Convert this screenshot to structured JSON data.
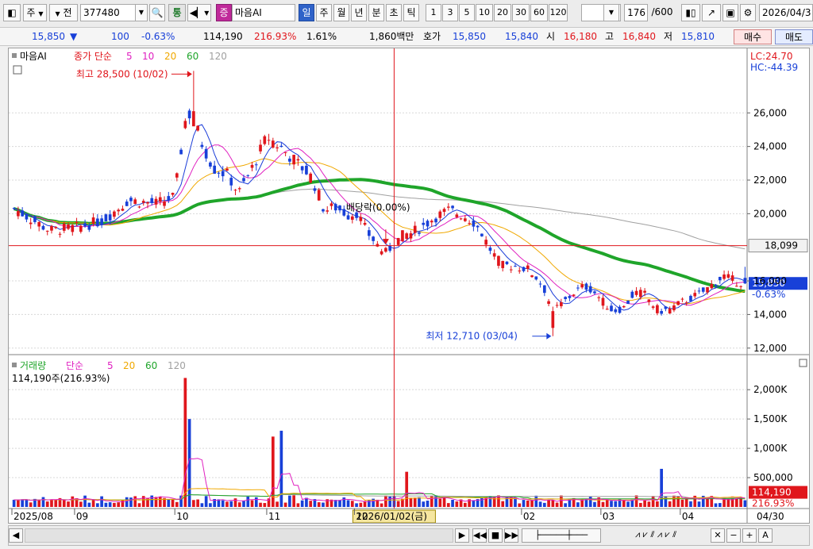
{
  "toolbar": {
    "stock_type": "주",
    "period_label": "전",
    "code": "377480",
    "tong_label": "통",
    "jeung_label": "증",
    "stock_name": "마음AI",
    "periods": [
      "일",
      "주",
      "월",
      "년",
      "분",
      "초",
      "틱"
    ],
    "active_period": "일",
    "minutes": [
      "1",
      "3",
      "5",
      "10",
      "20",
      "30",
      "60",
      "120"
    ],
    "count": "176",
    "count_total": "/600",
    "date": "2026/04/3"
  },
  "info": {
    "price": "15,850",
    "direction_arrow": "▼",
    "change": "100",
    "change_pct": "-0.63%",
    "volume": "114,190",
    "volume_pct": "216.93%",
    "turnover_pct": "1.61%",
    "amount": "1,860백만",
    "hoga_label": "호가",
    "ask": "15,850",
    "bid": "15,840",
    "open_label": "시",
    "open": "16,180",
    "high_label": "고",
    "high": "16,840",
    "low_label": "저",
    "low": "15,810",
    "buy_label": "매수",
    "sell_label": "매도"
  },
  "colors": {
    "up": "#e0161c",
    "down": "#1840d8",
    "ma5": "#1a3cd8",
    "ma10": "#e020c0",
    "ma20": "#f0a800",
    "ma60": "#1fa52a",
    "ma120": "#a0a0a0"
  },
  "chart_data": [
    {
      "type": "candlestick",
      "title": "마음AI",
      "legend": {
        "label": "종가 단순",
        "periods": [
          "5",
          "10",
          "20",
          "60",
          "120"
        ]
      },
      "y_ticks": [
        "26,000",
        "24,000",
        "22,000",
        "20,000",
        "16,000",
        "14,000",
        "12,000"
      ],
      "ylim": [
        11800,
        28800
      ],
      "lc_label": "LC:24.70",
      "hc_label": "HC:-44.39",
      "high_annotation": "최고 28,500 (10/02)",
      "low_annotation": "최저 12,710 (03/04)",
      "dividend_annotation": "배당락(0.00%)",
      "crosshair_price": "18,099",
      "crosshair_price_value": 18099,
      "last_price": "15,850",
      "last_price_value": 15850,
      "last_change": "-0.63%",
      "x_labels": [
        "2025/08",
        "09",
        "10",
        "11",
        "12",
        "02",
        "03",
        "04"
      ],
      "crosshair_date": "2026/01/02(금)",
      "end_date": "04/30"
    },
    {
      "type": "bar",
      "title": "거래량",
      "legend": {
        "label": "단순",
        "periods": [
          "5",
          "20",
          "60",
          "120"
        ]
      },
      "volume_label": "114,190주(216.93%)",
      "y_ticks": [
        "2,000K",
        "1,500K",
        "1,000K",
        "500,000"
      ],
      "ylim": [
        0,
        2300000
      ],
      "last_volume": "114,190",
      "last_volume_value": 114190,
      "last_volume_pct": "216.93%"
    }
  ]
}
